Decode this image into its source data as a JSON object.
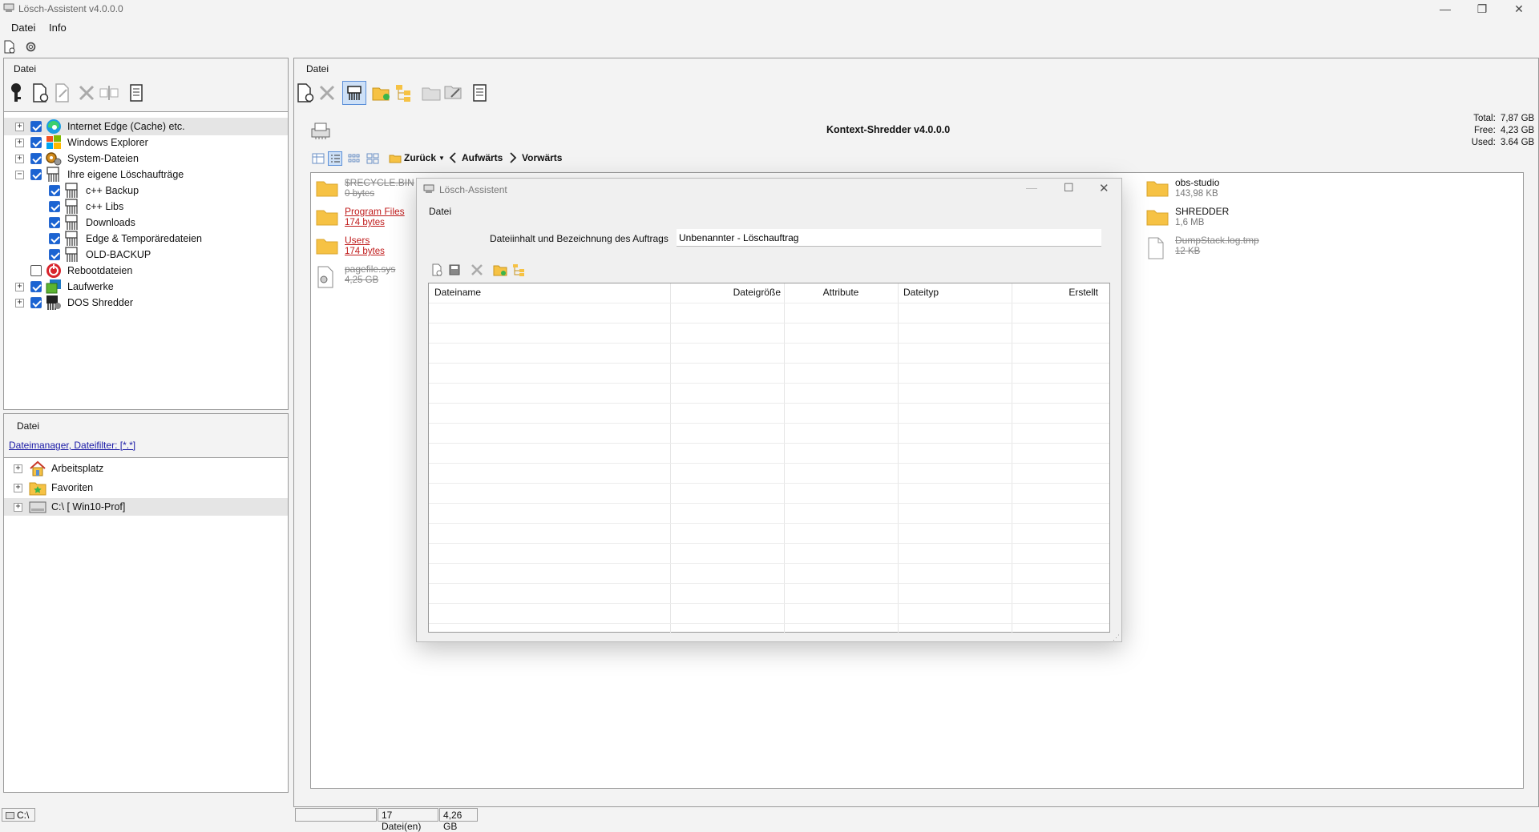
{
  "window": {
    "title": "Lösch-Assistent v4.0.0.0",
    "minimize": "—",
    "maximize": "❐",
    "close": "✕"
  },
  "menu": [
    "Datei",
    "Info"
  ],
  "left_top": {
    "header": "Datei",
    "tree": [
      {
        "label": "Internet  Edge (Cache) etc.",
        "checked": true,
        "expander": "+",
        "icon": "edge-icon"
      },
      {
        "label": "Windows Explorer",
        "checked": true,
        "expander": "+",
        "icon": "windows-logo-icon"
      },
      {
        "label": "System-Dateien",
        "checked": true,
        "expander": "+",
        "icon": "gears-icon"
      },
      {
        "label": "Ihre eigene Löschaufträge",
        "checked": true,
        "expander": "−",
        "icon": "shredder-icon"
      },
      {
        "label": "c++ Backup",
        "checked": true,
        "icon": "shredder-icon"
      },
      {
        "label": "c++ Libs",
        "checked": true,
        "icon": "shredder-icon"
      },
      {
        "label": "Downloads",
        "checked": true,
        "icon": "shredder-icon"
      },
      {
        "label": "Edge & Temporäredateien",
        "checked": true,
        "icon": "shredder-icon"
      },
      {
        "label": "OLD-BACKUP",
        "checked": true,
        "icon": "shredder-icon"
      },
      {
        "label": "Rebootdateien",
        "checked": false,
        "icon": "reboot-icon"
      },
      {
        "label": "Laufwerke",
        "checked": true,
        "expander": "+",
        "icon": "drives-icon"
      },
      {
        "label": "DOS Shredder",
        "checked": true,
        "expander": "+",
        "icon": "dos-shredder-icon"
      }
    ]
  },
  "left_bottom": {
    "header": "Datei",
    "filter_link": "Dateimanager, Dateifilter:   [*.*]",
    "tree": [
      {
        "label": "Arbeitsplatz",
        "expander": "+",
        "icon": "home-icon"
      },
      {
        "label": "Favoriten",
        "expander": "+",
        "icon": "favorites-folder-icon"
      },
      {
        "label": "C:\\ [ Win10-Prof]",
        "expander": "+",
        "icon": "drive-icon"
      }
    ]
  },
  "right": {
    "header": "Datei",
    "shredder_title": "Kontext-Shredder v4.0.0.0",
    "disk": {
      "total_label": "Total:",
      "total": "7,87 GB",
      "free_label": "Free:",
      "free": "4,23 GB",
      "used_label": "Used:",
      "used": "3.64 GB"
    },
    "nav": {
      "back": "Zurück",
      "up": "Aufwärts",
      "forward": "Vorwärts"
    },
    "files_left": [
      {
        "name": "$RECYCLE.BIN",
        "size": "0 bytes",
        "style": "struck",
        "type": "folder"
      },
      {
        "name": "Program Files",
        "size": "174 bytes",
        "style": "red",
        "type": "folder"
      },
      {
        "name": "Users",
        "size": "174 bytes",
        "style": "red",
        "type": "folder"
      },
      {
        "name": "pagefile.sys",
        "size": "4,25 GB",
        "style": "struck",
        "type": "sysfile"
      }
    ],
    "files_right": [
      {
        "name": "obs-studio",
        "size": "143,98 KB",
        "style": "normal",
        "type": "folder"
      },
      {
        "name": "SHREDDER",
        "size": "1,6 MB",
        "style": "normal",
        "type": "folder"
      },
      {
        "name": "DumpStack.log.tmp",
        "size": "12 KB",
        "style": "struck",
        "type": "file"
      }
    ]
  },
  "dialog": {
    "title": "Lösch-Assistent",
    "menu": "Datei",
    "field_label": "Dateiinhalt und Bezeichnung des Auftrags",
    "field_value": "Unbenannter - Löschauftrag",
    "columns": [
      "Dateiname",
      "Dateigröße",
      "Attribute",
      "Dateityp",
      "Erstellt"
    ]
  },
  "status": {
    "left_drive": "C:\\",
    "file_count": "17  Datei(en)",
    "total_size": "4,26 GB"
  }
}
